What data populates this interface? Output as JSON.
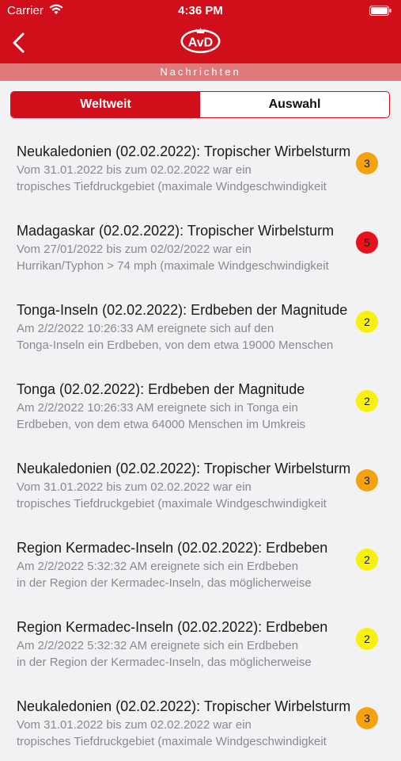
{
  "status_bar": {
    "carrier": "Carrier",
    "time": "4:36 PM"
  },
  "header": {
    "logo_text": "AvD",
    "subtitle": "Nachrichten"
  },
  "tabs": [
    {
      "label": "Weltweit",
      "active": true
    },
    {
      "label": "Auswahl",
      "active": false
    }
  ],
  "colors": {
    "brand_red": "#d10f1a",
    "badge_orange": "#f5a20f",
    "badge_red": "#e8121c",
    "badge_yellow": "#f8f20a"
  },
  "news": [
    {
      "title": "Neukaledonien  (02.02.2022): Tropischer Wirbelsturm",
      "line1": "Vom 31.01.2022 bis zum 02.02.2022 war ein",
      "line2": "tropisches Tiefdruckgebiet (maximale Windgeschwindigkeit",
      "level": "3",
      "color": "#f5a20f"
    },
    {
      "title": "Madagaskar  (02.02.2022): Tropischer Wirbelsturm",
      "line1": "Vom 27/01/2022 bis zum 02/02/2022 war ein",
      "line2": "Hurrikan/Typhon > 74 mph (maximale Windgeschwindigkeit",
      "level": "5",
      "color": "#e8121c"
    },
    {
      "title": "Tonga-Inseln  (02.02.2022): Erdbeben  der Magnitude",
      "line1": "Am 2/2/2022 10:26:33 AM ereignete sich auf den",
      "line2": "Tonga-Inseln ein Erdbeben, von dem etwa 19000 Menschen",
      "level": "2",
      "color": "#f8f20a"
    },
    {
      "title": "Tonga  (02.02.2022): Erdbeben  der Magnitude",
      "line1": "Am 2/2/2022 10:26:33 AM ereignete sich in Tonga ein",
      "line2": "Erdbeben, von dem etwa 64000 Menschen im Umkreis",
      "level": "2",
      "color": "#f8f20a"
    },
    {
      "title": "Neukaledonien  (02.02.2022): Tropischer Wirbelsturm",
      "line1": "Vom 31.01.2022 bis zum 02.02.2022 war ein",
      "line2": "tropisches Tiefdruckgebiet (maximale Windgeschwindigkeit",
      "level": "3",
      "color": "#f5a20f"
    },
    {
      "title": "Region Kermadec-Inseln  (02.02.2022): Erdbeben",
      "line1": "Am 2/2/2022 5:32:32 AM ereignete sich ein Erdbeben",
      "line2": "in der Region der Kermadec-Inseln, das möglicherweise",
      "level": "2",
      "color": "#f8f20a"
    },
    {
      "title": "Region Kermadec-Inseln  (02.02.2022): Erdbeben",
      "line1": "Am 2/2/2022 5:32:32 AM ereignete sich ein Erdbeben",
      "line2": "in der Region der Kermadec-Inseln, das möglicherweise",
      "level": "2",
      "color": "#f8f20a"
    },
    {
      "title": "Neukaledonien  (02.02.2022): Tropischer Wirbelsturm",
      "line1": "Vom 31.01.2022 bis zum 02.02.2022 war ein",
      "line2": "tropisches Tiefdruckgebiet (maximale Windgeschwindigkeit",
      "level": "3",
      "color": "#f5a20f"
    }
  ]
}
